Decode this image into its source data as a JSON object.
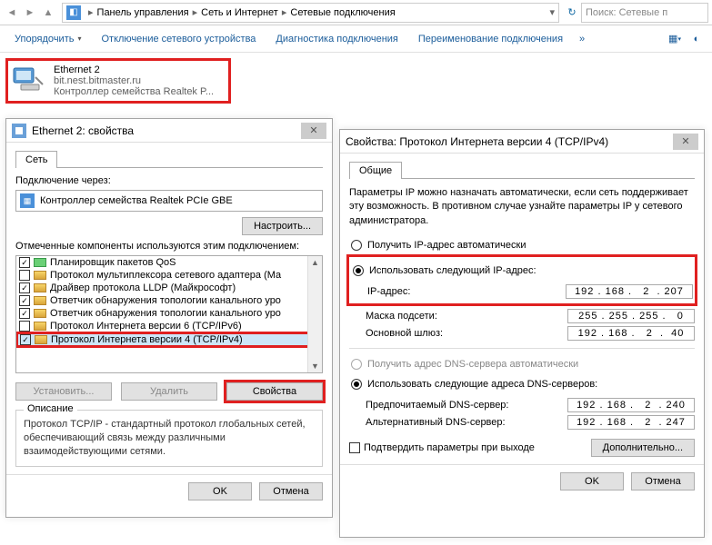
{
  "explorer": {
    "breadcrumb": [
      "Панель управления",
      "Сеть и Интернет",
      "Сетевые подключения"
    ],
    "search_placeholder": "Поиск: Сетевые п"
  },
  "toolbar": {
    "organize": "Упорядочить",
    "disable": "Отключение сетевого устройства",
    "diagnose": "Диагностика подключения",
    "rename": "Переименование подключения"
  },
  "adapter": {
    "name": "Ethernet 2",
    "domain": "bit.nest.bitmaster.ru",
    "device": "Контроллер семейства Realtek P..."
  },
  "props": {
    "title": "Ethernet 2: свойства",
    "tab_network": "Сеть",
    "connect_using": "Подключение через:",
    "adapter_name": "Контроллер семейства Realtek PCIe GBE",
    "configure": "Настроить...",
    "components_label": "Отмеченные компоненты используются этим подключением:",
    "components": [
      {
        "chk": true,
        "icon": "serv",
        "label": "Планировщик пакетов QoS"
      },
      {
        "chk": false,
        "icon": "net",
        "label": "Протокол мультиплексора сетевого адаптера (Ма"
      },
      {
        "chk": true,
        "icon": "net",
        "label": "Драйвер протокола LLDP (Майкрософт)"
      },
      {
        "chk": true,
        "icon": "net",
        "label": "Ответчик обнаружения топологии канального уро"
      },
      {
        "chk": true,
        "icon": "net",
        "label": "Ответчик обнаружения топологии канального уро"
      },
      {
        "chk": false,
        "icon": "net",
        "label": "Протокол Интернета версии 6 (TCP/IPv6)"
      },
      {
        "chk": true,
        "icon": "net",
        "label": "Протокол Интернета версии 4 (TCP/IPv4)",
        "sel": true,
        "hl": true
      }
    ],
    "install": "Установить...",
    "uninstall": "Удалить",
    "properties": "Свойства",
    "desc_label": "Описание",
    "desc_text": "Протокол TCP/IP - стандартный протокол глобальных сетей, обеспечивающий связь между различными взаимодействующими сетями.",
    "ok": "OK",
    "cancel": "Отмена"
  },
  "ipv4": {
    "title": "Свойства: Протокол Интернета версии 4 (TCP/IPv4)",
    "tab_general": "Общие",
    "intro": "Параметры IP можно назначать автоматически, если сеть поддерживает эту возможность. В противном случае узнайте параметры IP у сетевого администратора.",
    "radio_auto_ip": "Получить IP-адрес автоматически",
    "radio_manual_ip": "Использовать следующий IP-адрес:",
    "ip_label": "IP-адрес:",
    "ip_value": "192 . 168 .   2  . 207",
    "mask_label": "Маска подсети:",
    "mask_value": "255 . 255 . 255 .   0",
    "gw_label": "Основной шлюз:",
    "gw_value": "192 . 168 .   2  .  40",
    "radio_auto_dns": "Получить адрес DNS-сервера автоматически",
    "radio_manual_dns": "Использовать следующие адреса DNS-серверов:",
    "dns1_label": "Предпочитаемый DNS-сервер:",
    "dns1_value": "192 . 168 .   2  . 240",
    "dns2_label": "Альтернативный DNS-сервер:",
    "dns2_value": "192 . 168 .   2  . 247",
    "validate": "Подтвердить параметры при выходе",
    "advanced": "Дополнительно...",
    "ok": "OK",
    "cancel": "Отмена"
  }
}
